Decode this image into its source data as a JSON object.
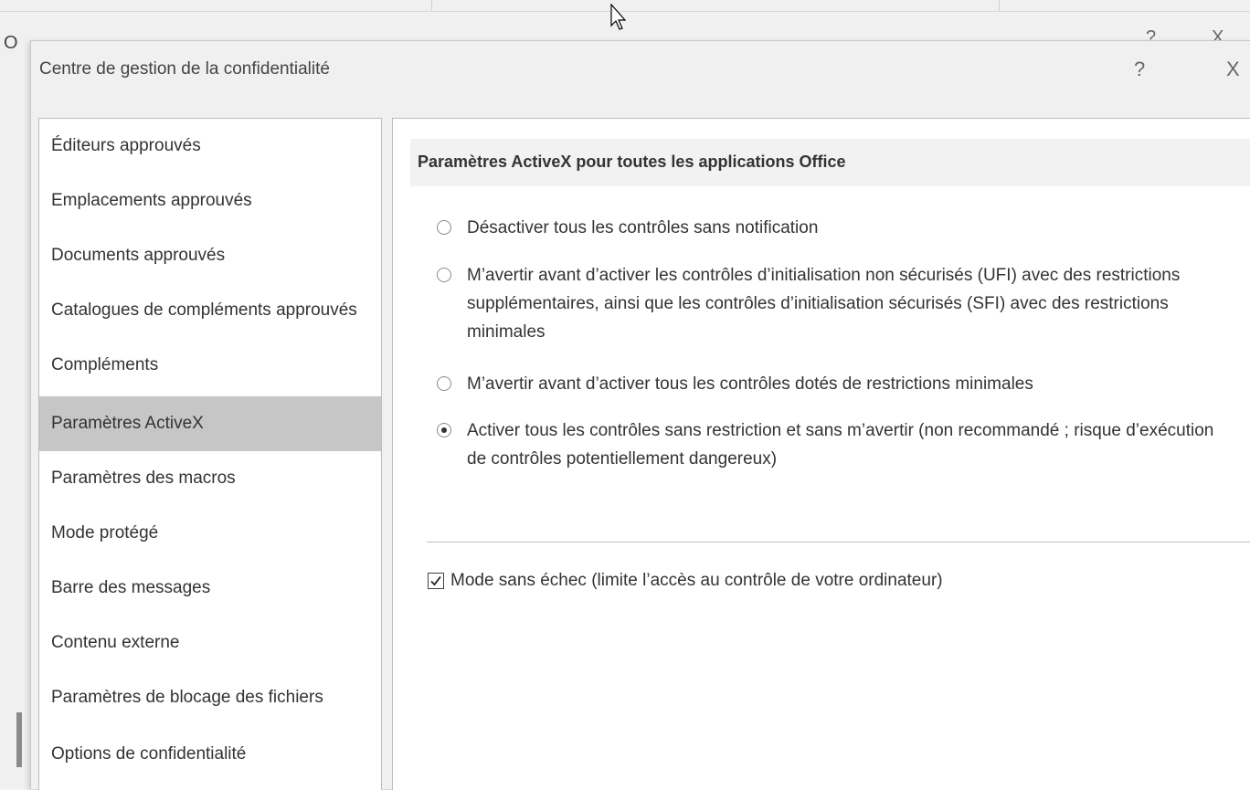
{
  "dialog": {
    "title": "Centre de gestion de la confidentialité",
    "help_label": "?",
    "close_label": "X"
  },
  "background_window": {
    "title_partial": "O",
    "help_label": "?",
    "close_label": "X"
  },
  "sidebar": {
    "items": [
      {
        "label": "Éditeurs approuvés",
        "selected": false
      },
      {
        "label": "Emplacements approuvés",
        "selected": false
      },
      {
        "label": "Documents approuvés",
        "selected": false
      },
      {
        "label": "Catalogues de compléments approuvés",
        "selected": false
      },
      {
        "label": "Compléments",
        "selected": false
      },
      {
        "label": "Paramètres ActiveX",
        "selected": true
      },
      {
        "label": "Paramètres des macros",
        "selected": false
      },
      {
        "label": "Mode protégé",
        "selected": false
      },
      {
        "label": "Barre des messages",
        "selected": false
      },
      {
        "label": "Contenu externe",
        "selected": false
      },
      {
        "label": "Paramètres de blocage des fichiers",
        "selected": false
      },
      {
        "label": "Options de confidentialité",
        "selected": false
      }
    ]
  },
  "activex": {
    "section_title": "Paramètres ActiveX pour toutes les applications Office",
    "options": [
      {
        "label": "Désactiver tous les contrôles sans notification",
        "checked": false
      },
      {
        "label": "M’avertir avant d’activer les contrôles d’initialisation non sécurisés (UFI) avec des restrictions supplémentaires, ainsi que les contrôles d’initialisation sécurisés (SFI) avec des restrictions minimales",
        "checked": false
      },
      {
        "label": "M’avertir avant d’activer tous les contrôles dotés de restrictions minimales",
        "checked": false
      },
      {
        "label": "Activer tous les contrôles sans restriction et sans m’avertir (non recommandé ; risque d’exécution de contrôles potentiellement dangereux)",
        "checked": true
      }
    ],
    "safe_mode": {
      "label": "Mode sans échec (limite l’accès au contrôle de votre ordinateur)",
      "checked": true
    }
  }
}
